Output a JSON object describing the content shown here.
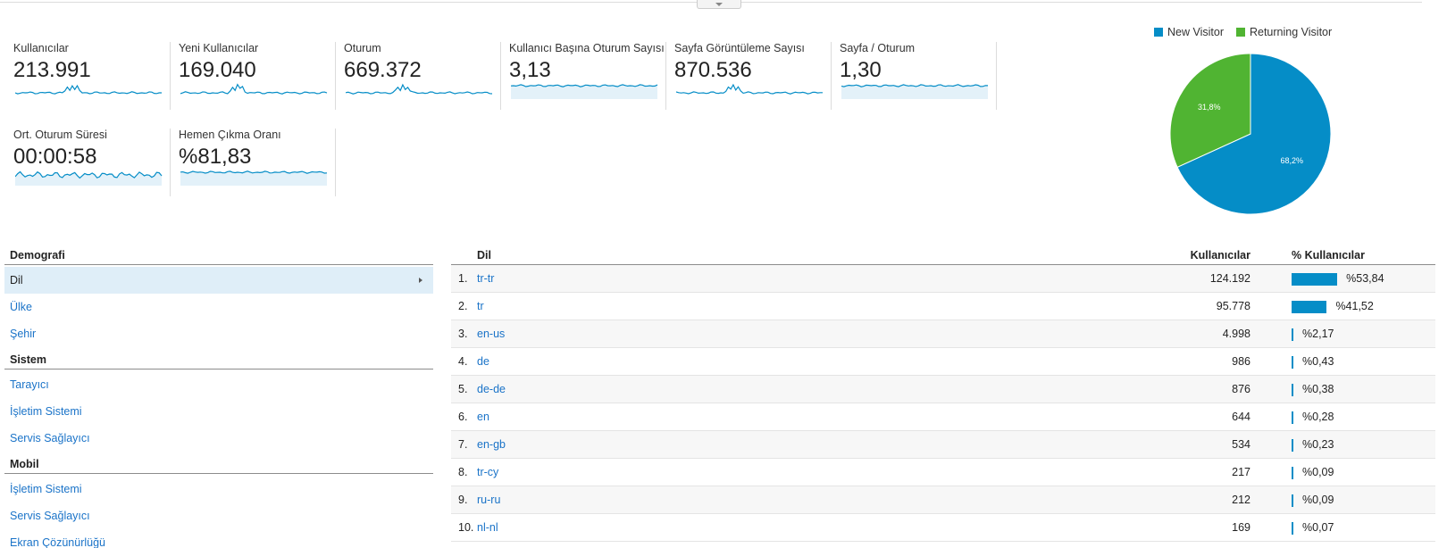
{
  "metrics": [
    {
      "label": "Kullanıcılar",
      "value": "213.991",
      "spark": "jagged"
    },
    {
      "label": "Yeni Kullanıcılar",
      "value": "169.040",
      "spark": "jagged"
    },
    {
      "label": "Oturum",
      "value": "669.372",
      "spark": "jagged"
    },
    {
      "label": "Kullanıcı Başına Oturum Sayısı",
      "value": "3,13",
      "spark": "filled"
    },
    {
      "label": "Sayfa Görüntüleme Sayısı",
      "value": "870.536",
      "spark": "jagged"
    },
    {
      "label": "Sayfa / Oturum",
      "value": "1,30",
      "spark": "filled"
    },
    {
      "label": "Ort. Oturum Süresi",
      "value": "00:00:58",
      "spark": "wave"
    },
    {
      "label": "Hemen Çıkma Oranı",
      "value": "%81,83",
      "spark": "filled"
    }
  ],
  "colors": {
    "accent": "#058dc7",
    "green": "#50b432",
    "link": "#1a73c8",
    "spark_fill": "#e3f1f9"
  },
  "chart_data": {
    "type": "pie",
    "legend": [
      "New Visitor",
      "Returning Visitor"
    ],
    "legend_position": "top",
    "slices": [
      {
        "name": "New Visitor",
        "value": 68.2,
        "label": "68,2%",
        "color": "#058dc7"
      },
      {
        "name": "Returning Visitor",
        "value": 31.8,
        "label": "31,8%",
        "color": "#50b432"
      }
    ]
  },
  "nav": {
    "sections": [
      {
        "title": "Demografi",
        "items": [
          {
            "label": "Dil",
            "active": true
          },
          {
            "label": "Ülke"
          },
          {
            "label": "Şehir"
          }
        ]
      },
      {
        "title": "Sistem",
        "items": [
          {
            "label": "Tarayıcı"
          },
          {
            "label": "İşletim Sistemi"
          },
          {
            "label": "Servis Sağlayıcı"
          }
        ]
      },
      {
        "title": "Mobil",
        "items": [
          {
            "label": "İşletim Sistemi"
          },
          {
            "label": "Servis Sağlayıcı"
          },
          {
            "label": "Ekran Çözünürlüğü"
          }
        ]
      }
    ]
  },
  "table": {
    "headers": {
      "dimension": "Dil",
      "users": "Kullanıcılar",
      "pct": "% Kullanıcılar"
    },
    "rows": [
      {
        "idx": "1.",
        "dim": "tr-tr",
        "users": "124.192",
        "pct": "%53,84",
        "share": 53.84
      },
      {
        "idx": "2.",
        "dim": "tr",
        "users": "95.778",
        "pct": "%41,52",
        "share": 41.52
      },
      {
        "idx": "3.",
        "dim": "en-us",
        "users": "4.998",
        "pct": "%2,17",
        "share": 2.17
      },
      {
        "idx": "4.",
        "dim": "de",
        "users": "986",
        "pct": "%0,43",
        "share": 0.43
      },
      {
        "idx": "5.",
        "dim": "de-de",
        "users": "876",
        "pct": "%0,38",
        "share": 0.38
      },
      {
        "idx": "6.",
        "dim": "en",
        "users": "644",
        "pct": "%0,28",
        "share": 0.28
      },
      {
        "idx": "7.",
        "dim": "en-gb",
        "users": "534",
        "pct": "%0,23",
        "share": 0.23
      },
      {
        "idx": "8.",
        "dim": "tr-cy",
        "users": "217",
        "pct": "%0,09",
        "share": 0.09
      },
      {
        "idx": "9.",
        "dim": "ru-ru",
        "users": "212",
        "pct": "%0,09",
        "share": 0.09
      },
      {
        "idx": "10.",
        "dim": "nl-nl",
        "users": "169",
        "pct": "%0,07",
        "share": 0.07
      }
    ]
  }
}
